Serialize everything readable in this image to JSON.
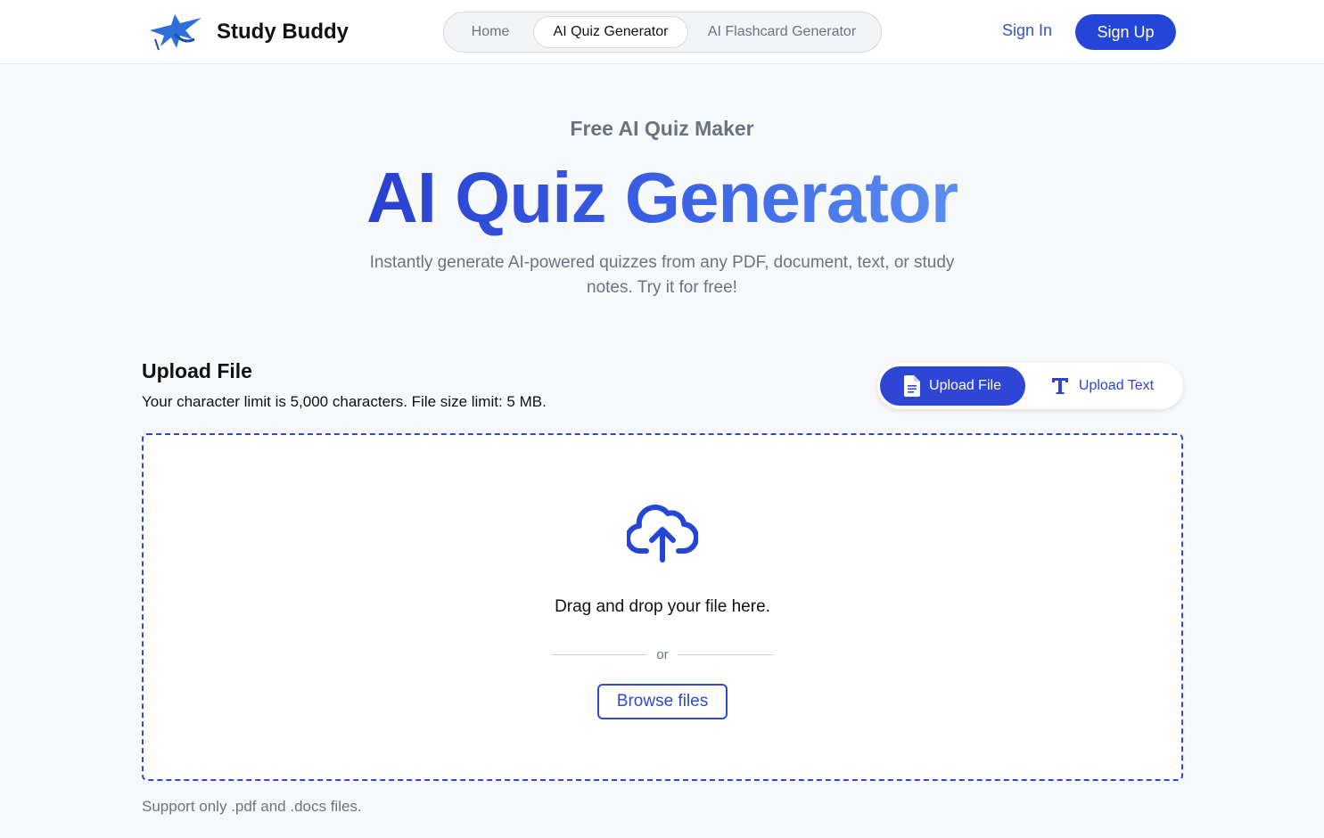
{
  "header": {
    "brand": "Study Buddy",
    "nav": [
      {
        "label": "Home"
      },
      {
        "label": "AI Quiz Generator",
        "active": true
      },
      {
        "label": "AI Flashcard Generator"
      }
    ],
    "sign_in": "Sign In",
    "sign_up": "Sign Up"
  },
  "hero": {
    "eyebrow": "Free AI Quiz Maker",
    "title": "AI Quiz Generator",
    "subtitle": "Instantly generate AI-powered quizzes from any PDF, document, text, or study notes. Try it for free!"
  },
  "upload": {
    "title": "Upload File",
    "limit_text": "Your character limit is 5,000 characters. File size limit: 5 MB.",
    "toggle": {
      "file_label": "Upload File",
      "text_label": "Upload Text",
      "selected": "file"
    },
    "dropzone": {
      "icon": "cloud-upload-icon",
      "drop_text": "Drag and drop your file here.",
      "or_text": "or",
      "browse_label": "Browse files"
    },
    "support_text": "Support only .pdf and .docs files."
  },
  "colors": {
    "accent": "#2446d8",
    "muted_text": "#6b7280",
    "background": "#f7f8fa"
  }
}
